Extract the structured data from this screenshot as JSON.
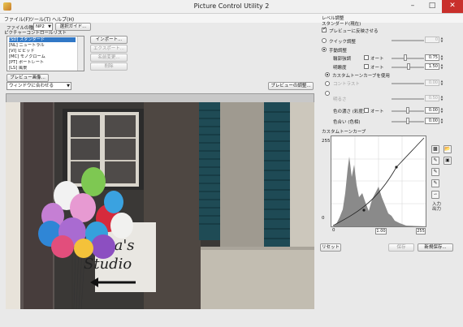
{
  "window": {
    "title": "Picture Control Utility 2"
  },
  "menu": {
    "items": [
      "ファイル(F)",
      "ツール(T)",
      "ヘルプ(H)"
    ]
  },
  "file_type": {
    "label": "ファイルの種類:",
    "value": "NP2",
    "guide_button": "選択ガイド..."
  },
  "picture_control_list": {
    "heading": "ピクチャーコントロールリスト",
    "items": [
      "[SD] スタンダード",
      "[NL] ニュートラル",
      "[VI] ビビッド",
      "[MC] モノクローム",
      "[PT] ポートレート",
      "[LS] 風景"
    ],
    "selected_index": 0
  },
  "list_actions": {
    "import": "インポート...",
    "export": "エクスポート...",
    "rename": "名前変更...",
    "delete": "削除"
  },
  "preview": {
    "image_button": "プレビュー画像...",
    "fit_option": "ウィンドウに合わせる",
    "adjust_button": "プレビューの調整..."
  },
  "photo": {
    "sign_text_1": "na's",
    "sign_text_2": "Studio"
  },
  "right_panel": {
    "section_label": "レベル調整",
    "current_label": "スタンダード(現在)",
    "apply_preview": "プレビューに反映させる",
    "quick_adjust": "クイック調整",
    "manual_adjust": "手動調整",
    "sharpness_label": "輪郭強調",
    "sharpness_value": "0.75",
    "clarity_label": "明瞭度",
    "clarity_value": "1.50",
    "auto_label": "オート",
    "custom_curve": "カスタムトーンカーブを使用",
    "contrast_label": "コントラスト",
    "brightness_label": "明るさ",
    "quick_value": "0",
    "contrast_value": "0.00",
    "brightness_value": "0.50",
    "saturation_label": "色の濃さ (彩度)",
    "saturation_value": "0.00",
    "hue_label": "色合い (色相)",
    "hue_value": "0.00",
    "curve_heading": "カスタムトーンカーブ",
    "curve_y_top": "255",
    "curve_y_bottom": "0",
    "curve_x_left": "0",
    "curve_x_mid": "1.00",
    "curve_x_right": "255",
    "io_label": "入力\n出力",
    "reset_button": "リセット",
    "save_button": "保存",
    "save_as_button": "新規保存..."
  }
}
